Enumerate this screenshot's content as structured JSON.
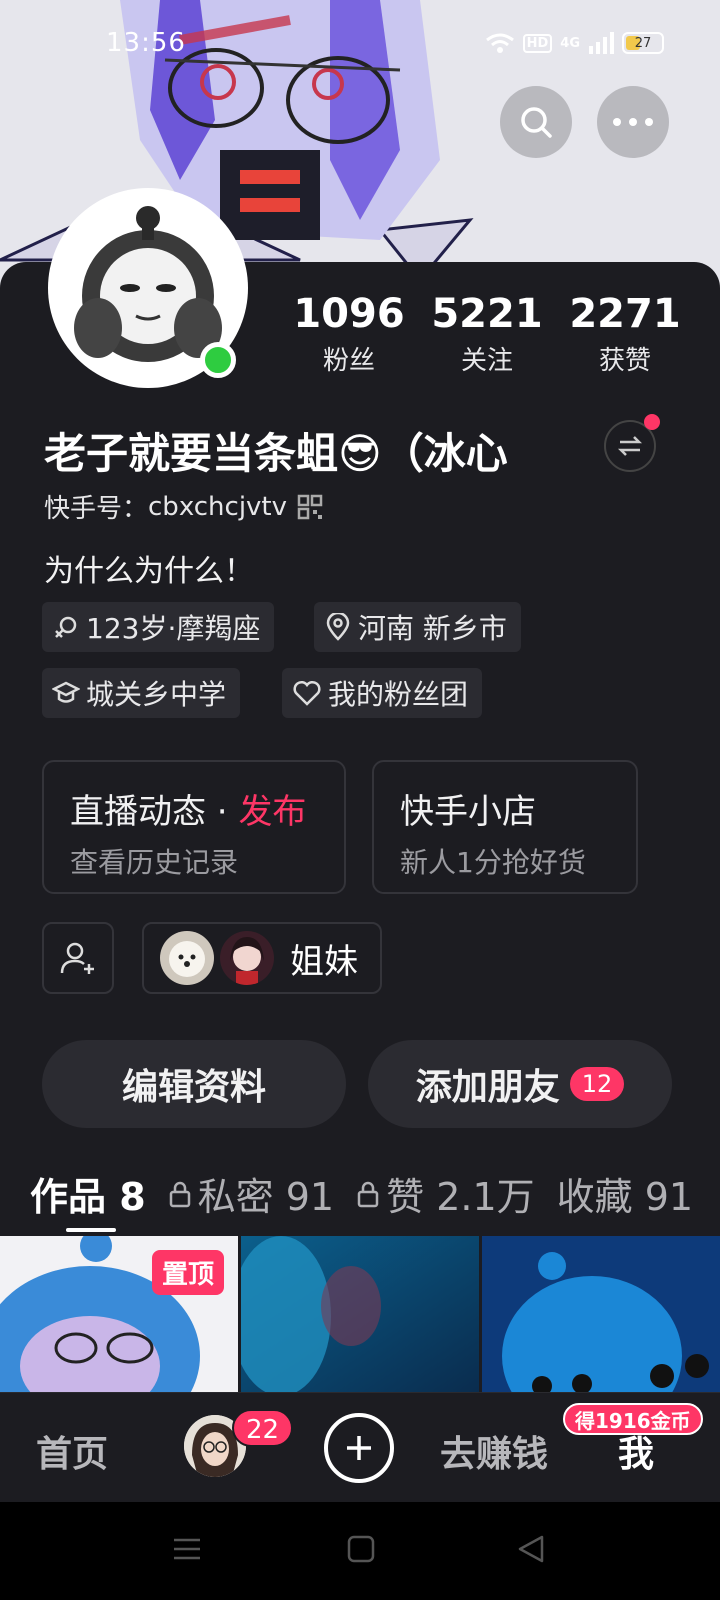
{
  "status_bar": {
    "time": "13:56",
    "battery": "27",
    "network": "4G",
    "hd": "HD"
  },
  "profile": {
    "stats": [
      {
        "value": "1096",
        "label": "粉丝"
      },
      {
        "value": "5221",
        "label": "关注"
      },
      {
        "value": "2271",
        "label": "获赞"
      }
    ],
    "name": "老子就要当条蛆😎（冰心",
    "kuaishou_id_label": "快手号：",
    "kuaishou_id": "cbxchcjvtv",
    "bio": "为什么为什么！",
    "tags": {
      "age": "123岁·摩羯座",
      "location": "河南 新乡市",
      "school": "城关乡中学",
      "fan_group": "我的粉丝团"
    }
  },
  "feature_boxes": {
    "live": {
      "title": "直播动态 · ",
      "title_highlight": "发布",
      "subtitle": "查看历史记录"
    },
    "shop": {
      "title": "快手小店",
      "subtitle": "新人1分抢好货"
    }
  },
  "sisters_label": "姐妹",
  "actions": {
    "edit_label": "编辑资料",
    "add_friend_label": "添加朋友",
    "add_friend_badge": "12"
  },
  "tabs": [
    {
      "label": "作品 8"
    },
    {
      "label": "私密 91"
    },
    {
      "label": "赞 2.1万"
    },
    {
      "label": "收藏 91"
    }
  ],
  "pinned_label": "置顶",
  "bottom_nav": {
    "home": "首页",
    "messages_badge": "22",
    "earn": "去赚钱",
    "me": "我",
    "coin_badge": "得1916金币"
  },
  "colors": {
    "accent": "#fe3666",
    "card_bg": "#1c1c21",
    "online": "#2ecc40"
  }
}
